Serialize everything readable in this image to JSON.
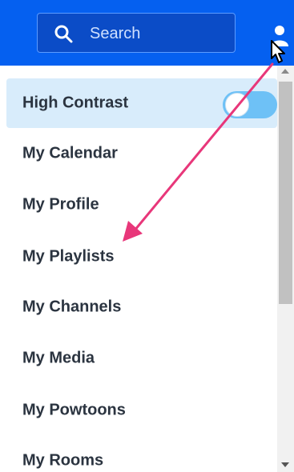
{
  "header": {
    "search_placeholder": "Search",
    "background_color": "#0560f0"
  },
  "icons": {
    "search": "search-icon",
    "user": "user-icon",
    "cursor": "cursor-icon"
  },
  "menu": {
    "items": [
      {
        "label": "High Contrast",
        "has_toggle": true,
        "toggle_on": true
      },
      {
        "label": "My Calendar"
      },
      {
        "label": "My Profile"
      },
      {
        "label": "My Playlists"
      },
      {
        "label": "My Channels"
      },
      {
        "label": "My Media"
      },
      {
        "label": "My Powtoons"
      },
      {
        "label": "My Rooms"
      }
    ],
    "highlight_color": "#d8ecfb",
    "toggle_color": "#6ec1f6"
  },
  "annotation": {
    "arrow_color": "#e8377a"
  }
}
